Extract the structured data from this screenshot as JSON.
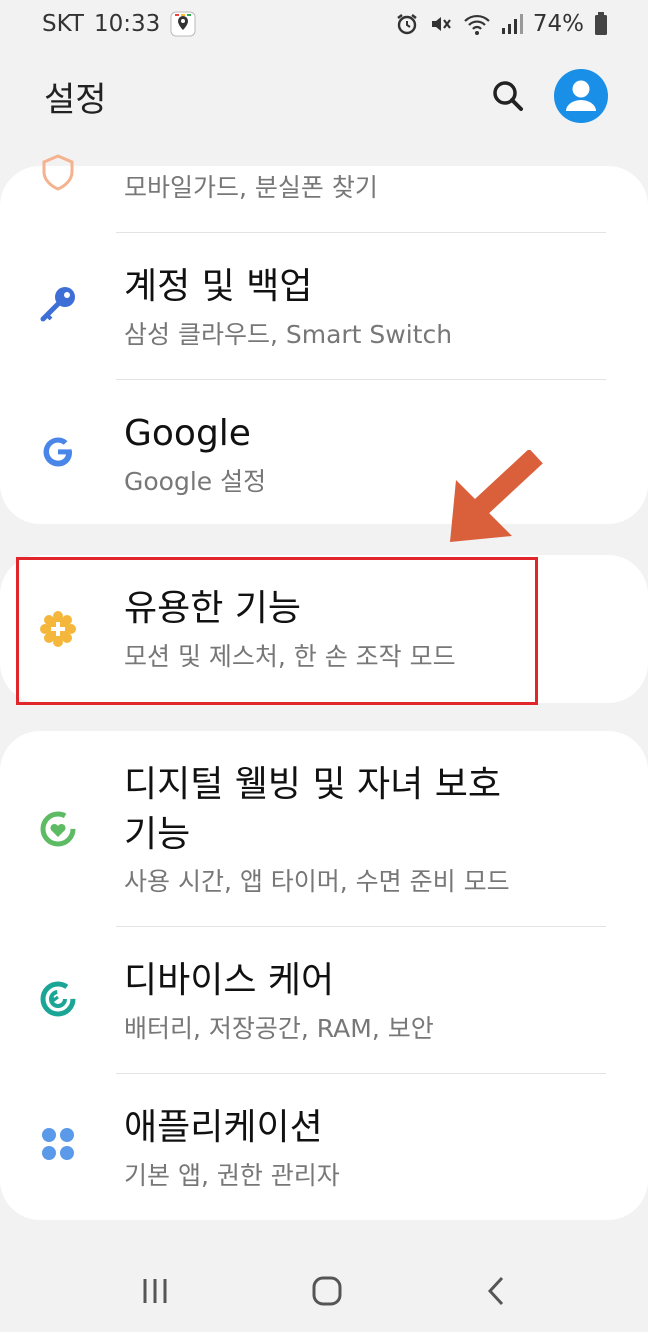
{
  "status_bar": {
    "carrier": "SKT",
    "time": "10:33",
    "battery": "74%"
  },
  "header": {
    "title": "설정"
  },
  "items": [
    {
      "title": "",
      "subtitle": "모바일가드, 분실폰 찾기",
      "icon": "shield-icon"
    },
    {
      "title": "계정 및 백업",
      "subtitle": "삼성 클라우드, Smart Switch",
      "icon": "key-icon"
    },
    {
      "title": "Google",
      "subtitle": "Google 설정",
      "icon": "google-icon"
    },
    {
      "title": "유용한 기능",
      "subtitle": "모션 및 제스처, 한 손 조작 모드",
      "icon": "puzzle-plus-icon"
    },
    {
      "title": "디지털 웰빙 및 자녀 보호",
      "title2": "기능",
      "subtitle": "사용 시간, 앱 타이머, 수면 준비 모드",
      "icon": "wellbeing-icon"
    },
    {
      "title": "디바이스 케어",
      "subtitle": "배터리, 저장공간, RAM, 보안",
      "icon": "device-care-icon"
    },
    {
      "title": "애플리케이션",
      "subtitle": "기본 앱, 권한 관리자",
      "icon": "apps-icon"
    }
  ],
  "colors": {
    "accent_blue": "#1a8fe8",
    "highlight_red": "#e0252b",
    "arrow_orange": "#d9603a",
    "key_blue": "#3d6fd6",
    "google_blue": "#4a86e8",
    "feature_yellow": "#f5b73b",
    "wellbeing_green": "#5dbb63",
    "care_teal": "#1aa596",
    "apps_blue": "#5b9ae8"
  }
}
